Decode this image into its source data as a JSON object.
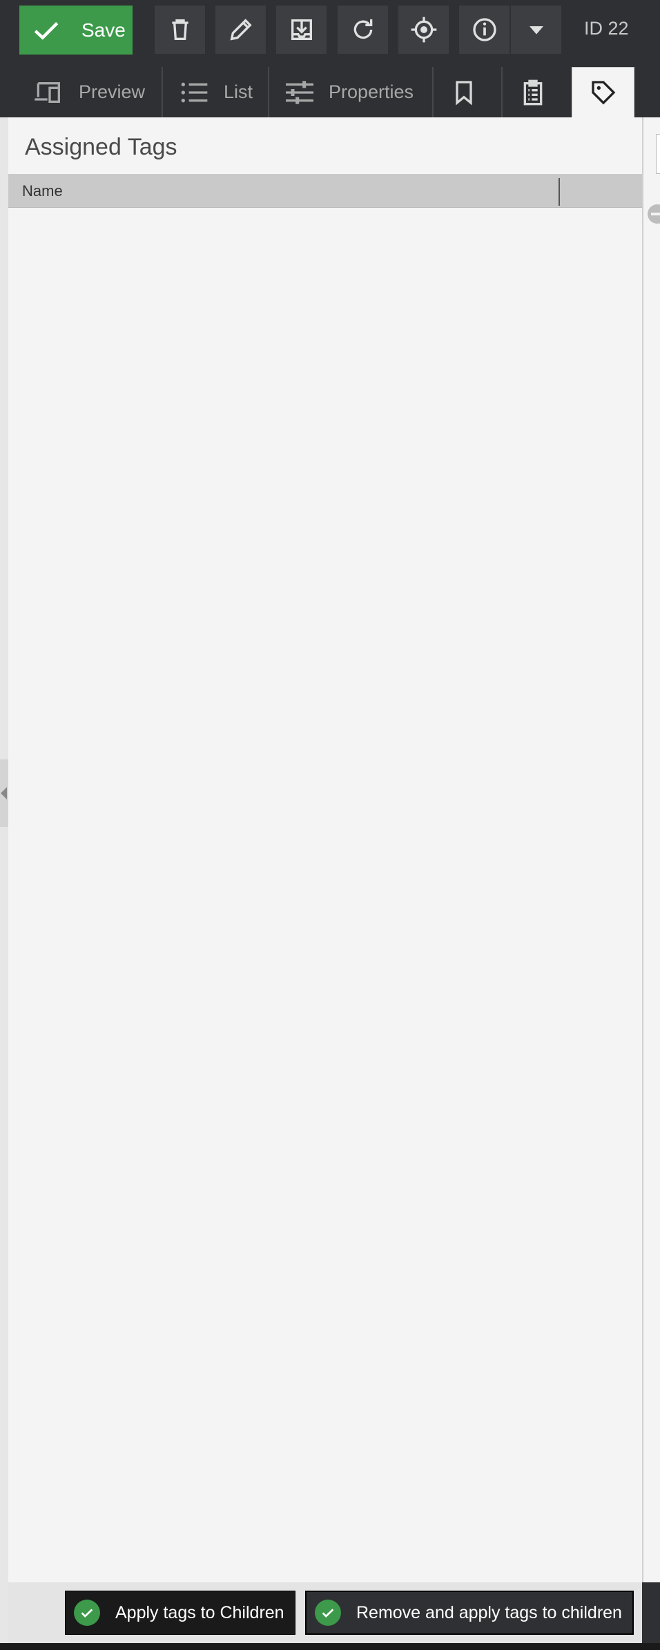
{
  "toolbar": {
    "save_label": "Save",
    "buttons": [
      {
        "icon": "trash-icon"
      },
      {
        "icon": "pencil-icon"
      },
      {
        "icon": "download-icon"
      },
      {
        "icon": "reload-icon"
      },
      {
        "icon": "target-icon"
      },
      {
        "icon": "info-icon"
      },
      {
        "icon": "caret-down-icon"
      }
    ],
    "id_label": "ID 22"
  },
  "tabs": {
    "preview": "Preview",
    "list": "List",
    "properties": "Properties",
    "bookmark": "",
    "clipboard": "",
    "tags": ""
  },
  "panel": {
    "title": "Assigned Tags",
    "columns": [
      "Name"
    ],
    "rows": []
  },
  "footer": {
    "apply_label": "Apply tags to Children",
    "remove_apply_label": "Remove and apply tags to children"
  },
  "colors": {
    "accent": "#3c9a4a",
    "toolbar_bg": "#2f3033",
    "panel_bg": "#f4f4f4"
  }
}
